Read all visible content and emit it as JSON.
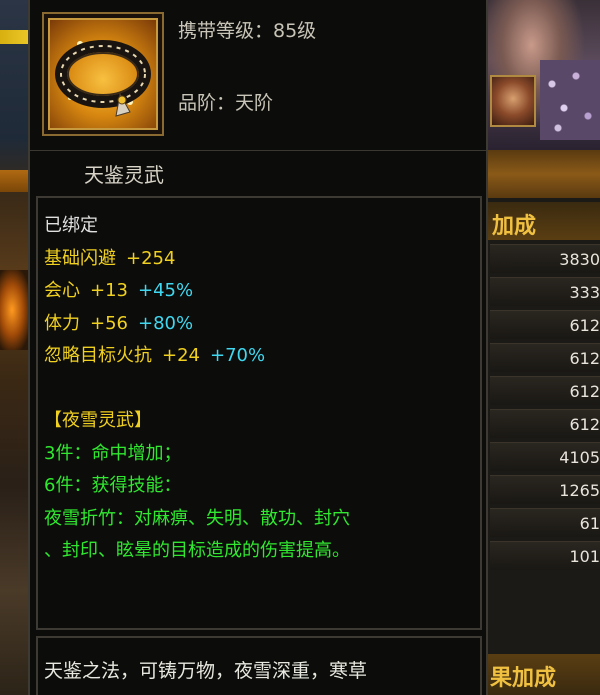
{
  "item": {
    "icon": "leather-collar-icon",
    "carry_level": "携带等级：85级",
    "grade": "品阶：天阶",
    "name": "天鉴灵武"
  },
  "stats": {
    "bound": "已绑定",
    "attributes": [
      {
        "name": "基础闪避",
        "value": "+254",
        "percent": ""
      },
      {
        "name": "会心",
        "value": "+13",
        "percent": "+45%"
      },
      {
        "name": "体力",
        "value": "+56",
        "percent": "+80%"
      },
      {
        "name": "忽略目标火抗",
        "value": "+24",
        "percent": "+70%"
      }
    ],
    "set_name": "【夜雪灵武】",
    "set_bonus_3": "3件：命中增加；",
    "set_bonus_6": "6件：获得技能：",
    "skill_line_1": "夜雪折竹：对麻痹、失明、散功、封穴",
    "skill_line_2": "、封印、眩晕的目标造成的伤害提高。"
  },
  "lore": "天鉴之法，可铸万物，夜雪深重，寒草",
  "side_panel": {
    "header": "加成",
    "values": [
      "3830",
      "333",
      "612",
      "612",
      "612",
      "612",
      "4105",
      "1265",
      "61",
      "101"
    ],
    "footer": "果加成"
  },
  "colors": {
    "bound_text": "#e0e0e0",
    "attribute_gold": "#f0d020",
    "percent_cyan": "#40d8f0",
    "set_green": "#30e830",
    "panel_gold": "#f0c040"
  }
}
